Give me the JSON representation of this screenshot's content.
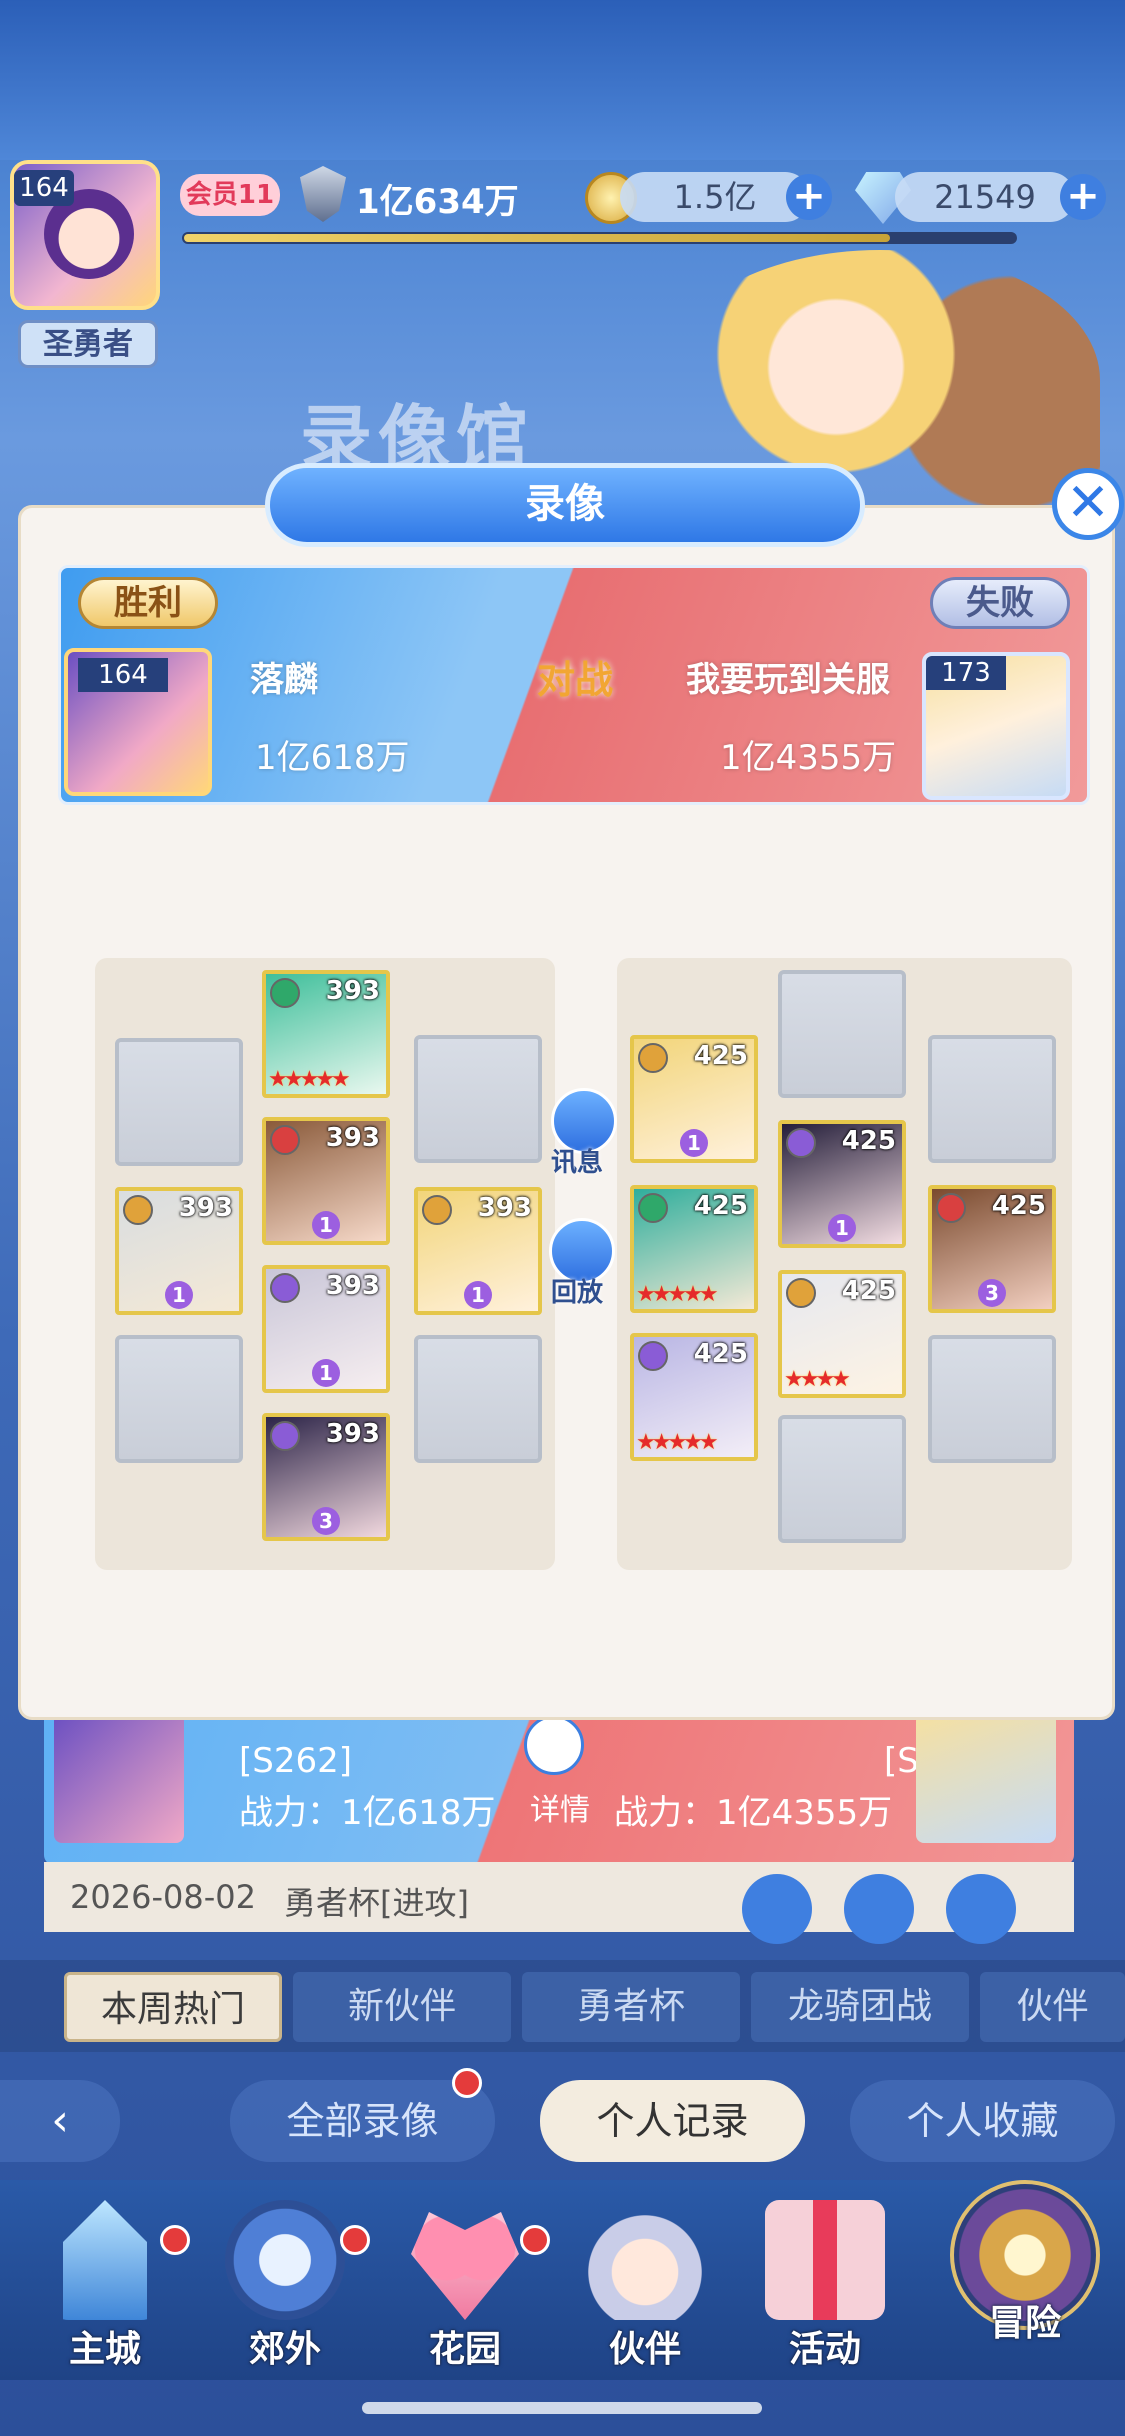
{
  "player": {
    "level": "164",
    "vip": "会员11",
    "power": "1亿634万",
    "title": "圣勇者",
    "xp_fraction": 0.85
  },
  "resources": [
    {
      "value": "1.5亿",
      "icon": "coin-icon"
    },
    {
      "value": "21549",
      "icon": "gem-icon"
    }
  ],
  "hall_title": "录像馆",
  "modal": {
    "title": "录像",
    "left": {
      "result": "胜利",
      "level": "164",
      "name": "落麟",
      "power": "1亿618万"
    },
    "right": {
      "result": "失败",
      "level": "173",
      "name": "我要玩到关服",
      "power": "1亿4355万"
    },
    "vs": "对战",
    "buttons": {
      "info": "讯息",
      "replay": "回放"
    },
    "left_team": [
      {
        "level": "393",
        "star_num": "",
        "stars": 5
      },
      {
        "level": "393",
        "star_num": "1",
        "stars": 0
      },
      {
        "level": "393",
        "star_num": "1",
        "stars": 0
      },
      {
        "level": "393",
        "star_num": "1",
        "stars": 0
      },
      {
        "level": "393",
        "star_num": "1",
        "stars": 0
      },
      {
        "level": "393",
        "star_num": "3",
        "stars": 0
      }
    ],
    "right_team": [
      {
        "level": "425",
        "star_num": "1",
        "stars": 0
      },
      {
        "level": "425",
        "star_num": "1",
        "stars": 0
      },
      {
        "level": "425",
        "star_num": "",
        "stars": 5
      },
      {
        "level": "425",
        "star_num": "3",
        "stars": 0
      },
      {
        "level": "425",
        "star_num": "",
        "stars": 4
      },
      {
        "level": "425",
        "star_num": "",
        "stars": 5
      }
    ]
  },
  "record": {
    "left_server": "[S262]",
    "left_power": "战力：1亿618万",
    "right_server": "[S262]",
    "right_power": "战力：1亿4355万",
    "detail": "详情",
    "date": "2026-08-02",
    "event": "勇者杯[进攻]"
  },
  "tabs": [
    "本周热门",
    "新伙伴",
    "勇者杯",
    "龙骑团战",
    "伙伴"
  ],
  "filters": [
    "全部录像",
    "个人记录",
    "个人收藏"
  ],
  "nav": [
    "主城",
    "郊外",
    "花园",
    "伙伴",
    "活动",
    "冒险"
  ],
  "colors": {
    "win": "#3f9cf0",
    "lose": "#e86f72",
    "accent": "#2f78e6"
  }
}
